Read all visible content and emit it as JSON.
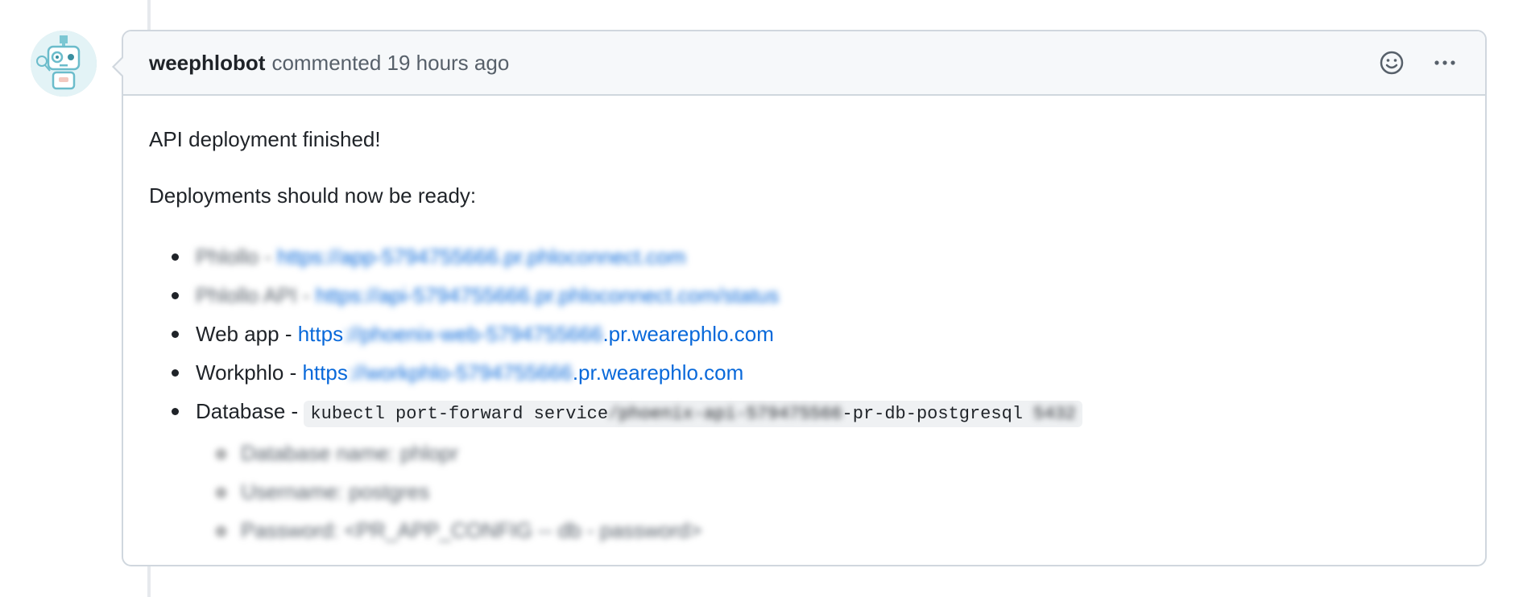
{
  "comment": {
    "author": "weephlobot",
    "meta": "commented 19 hours ago",
    "icons": {
      "reaction": "smiley-icon",
      "menu": "kebab-horizontal-icon"
    },
    "body": {
      "heading": "API deployment finished!",
      "intro": "Deployments should now be ready:",
      "items": [
        {
          "label": "Phlollo",
          "sep": " - ",
          "link": "https://app-5794755666.pr.phloconnect.com",
          "blurred": true
        },
        {
          "label": "Phlollo API",
          "sep": " - ",
          "link": "https://api-5794755666.pr.phloconnect.com/status",
          "blurred": true
        },
        {
          "label": "Web app",
          "sep": " - ",
          "link_start": "https",
          "link_hidden": "://phoenix-web-5794755666",
          "link_end": ".pr.wearephlo.com"
        },
        {
          "label": "Workphlo",
          "sep": " - ",
          "link_start": "https",
          "link_hidden": "://workphlo-5794755666",
          "link_end": ".pr.wearephlo.com"
        },
        {
          "label": "Database",
          "sep": " - ",
          "code_start": "kubectl port-forward service",
          "code_hidden": "/phoenix-api-579475566",
          "code_end": "-pr-db-postgresql",
          "code_tail": " 5432"
        }
      ],
      "database_details": [
        "Database name: phlopr",
        "Username: postgres",
        "Password: <PR_APP_CONFIG -- db - password>"
      ]
    }
  },
  "colors": {
    "link": "#0969da",
    "border": "#d0d7de",
    "header_bg": "#f6f8fa"
  }
}
